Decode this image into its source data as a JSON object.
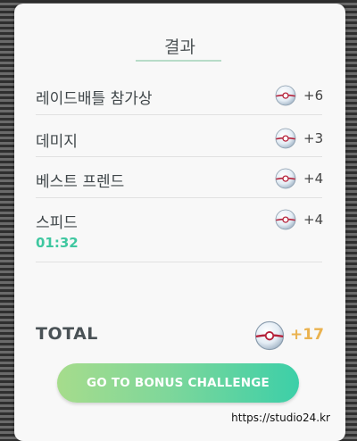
{
  "title": "결과",
  "rows": [
    {
      "label": "레이드배틀 참가상",
      "reward": "+6"
    },
    {
      "label": "데미지",
      "reward": "+3"
    },
    {
      "label": "베스트 프렌드",
      "reward": "+4"
    },
    {
      "label": "스피드",
      "sub": "01:32",
      "reward": "+4"
    }
  ],
  "total": {
    "label": "TOTAL",
    "value": "+17"
  },
  "bonus_button": {
    "label": "GO TO BONUS CHALLENGE"
  },
  "watermark": "https://studio24.kr",
  "colors": {
    "accent_green": "#3fc7a0",
    "total_gold": "#eab24f",
    "ball_red": "#b5213a"
  },
  "icons": {
    "reward": "premier-ball-icon"
  }
}
